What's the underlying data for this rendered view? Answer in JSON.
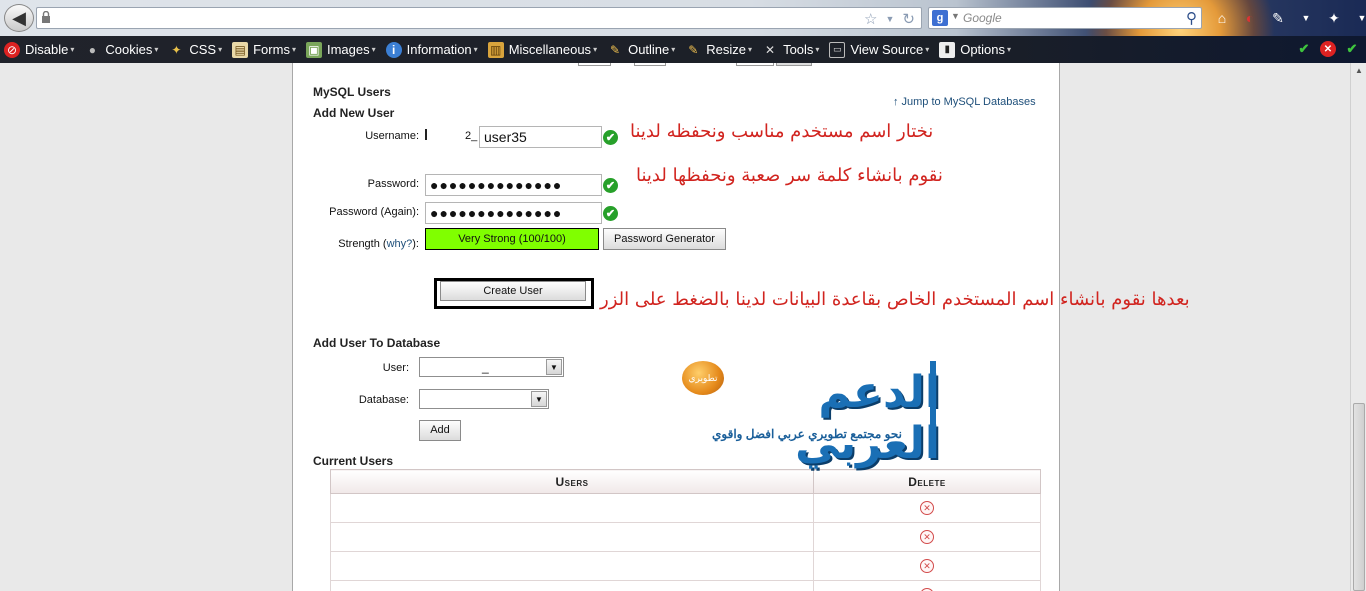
{
  "browser": {
    "url_text": "",
    "search_placeholder": "Google",
    "search_engine_letter": "g"
  },
  "toolbar": {
    "items": [
      {
        "label": "Disable",
        "icon": "disable-icon"
      },
      {
        "label": "Cookies",
        "icon": "cookies-icon"
      },
      {
        "label": "CSS",
        "icon": "css-icon"
      },
      {
        "label": "Forms",
        "icon": "forms-icon"
      },
      {
        "label": "Images",
        "icon": "images-icon"
      },
      {
        "label": "Information",
        "icon": "information-icon"
      },
      {
        "label": "Miscellaneous",
        "icon": "miscellaneous-icon"
      },
      {
        "label": "Outline",
        "icon": "outline-icon"
      },
      {
        "label": "Resize",
        "icon": "resize-icon"
      },
      {
        "label": "Tools",
        "icon": "tools-icon"
      },
      {
        "label": "View Source",
        "icon": "view-source-icon"
      },
      {
        "label": "Options",
        "icon": "options-icon"
      }
    ]
  },
  "page": {
    "mysql_users_title": "MySQL Users",
    "add_new_user_title": "Add New User",
    "jump_link": "Jump to MySQL Databases",
    "username_label": "Username:",
    "username_prefix": "2_",
    "username_value": "user35",
    "password_label": "Password:",
    "password_value": "●●●●●●●●●●●●●●",
    "password_again_label": "Password (Again):",
    "password_again_value": "●●●●●●●●●●●●●●",
    "strength_label": "Strength (",
    "strength_why": "why?",
    "strength_label_end": "):",
    "strength_value": "Very Strong (100/100)",
    "password_generator_label": "Password Generator",
    "create_user_label": "Create User",
    "add_user_to_db_title": "Add User To Database",
    "user_label": "User:",
    "user_select_value": "_",
    "database_label": "Database:",
    "database_select_value": "",
    "add_button_label": "Add",
    "current_users_title": "Current Users",
    "table_headers": [
      "Users",
      "Delete"
    ],
    "table_rows": [
      "",
      "",
      "",
      ""
    ]
  },
  "annotations": {
    "username_note": "نختار اسم مستخدم مناسب ونحفظه لدينا",
    "password_note": "نقوم بانشاء كلمة سر صعبة ونحفظها لدينا",
    "create_note": "بعدها نقوم بانشاء اسم المستخدم الخاص بقاعدة البيانات لدينا بالضغط على الزر"
  },
  "logo": {
    "main": "الدعم العربي",
    "sub": "نحو مجتمع تطويري عربي افضل واقوي",
    "badge": "تطويري"
  },
  "colors": {
    "strength_fill": "#80ff00",
    "check_green": "#27a02a",
    "annotation_red": "#d1241f",
    "link_blue": "#1e4f7a",
    "logo_blue": "#1a6fb5"
  }
}
